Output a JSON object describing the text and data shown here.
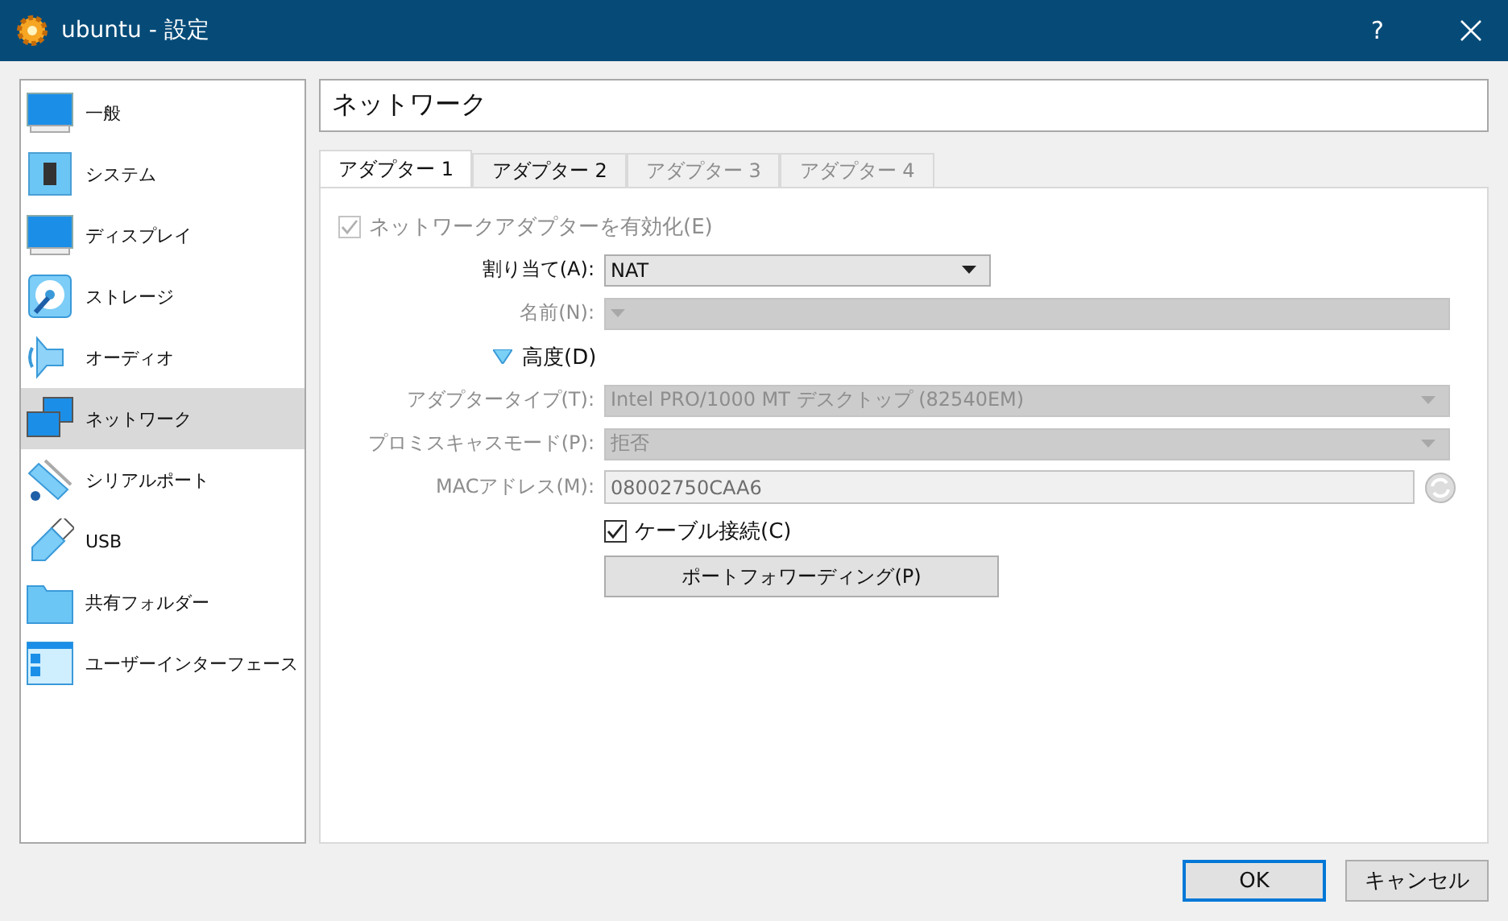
{
  "window": {
    "title": "ubuntu - 設定",
    "help": "?"
  },
  "sidebar": {
    "items": [
      {
        "label": "一般",
        "selected": false
      },
      {
        "label": "システム",
        "selected": false
      },
      {
        "label": "ディスプレイ",
        "selected": false
      },
      {
        "label": "ストレージ",
        "selected": false
      },
      {
        "label": "オーディオ",
        "selected": false
      },
      {
        "label": "ネットワーク",
        "selected": true
      },
      {
        "label": "シリアルポート",
        "selected": false
      },
      {
        "label": "USB",
        "selected": false
      },
      {
        "label": "共有フォルダー",
        "selected": false
      },
      {
        "label": "ユーザーインターフェース",
        "selected": false
      }
    ]
  },
  "page_title": "ネットワーク",
  "tabs": [
    {
      "label": "アダプター 1",
      "selected": true,
      "disabled": false
    },
    {
      "label": "アダプター 2",
      "selected": false,
      "disabled": false
    },
    {
      "label": "アダプター 3",
      "selected": false,
      "disabled": true
    },
    {
      "label": "アダプター 4",
      "selected": false,
      "disabled": true
    }
  ],
  "form": [
    {
      "kind": "checkbox",
      "label": "ネットワークアダプターを有効化(E)",
      "checked": true,
      "disabled": true
    },
    {
      "kind": "select",
      "label": "割り当て(A):",
      "value": "NAT",
      "disabled": false
    },
    {
      "kind": "select",
      "label": "名前(N):",
      "disabled": true
    },
    {
      "kind": "expander",
      "label": "高度(D)",
      "expanded": true
    },
    {
      "kind": "select",
      "label": "アダプタータイプ(T):",
      "value": "Intel PRO/1000 MT デスクトップ (82540EM)",
      "disabled": true
    },
    {
      "kind": "select",
      "label": "プロミスキャスモード(P):",
      "value": "拒否",
      "disabled": true
    },
    {
      "kind": "text",
      "label": "MACアドレス(M):",
      "value": "08002750CAA6",
      "disabled": true
    },
    {
      "kind": "checkbox",
      "label": "ケーブル接続(C)",
      "checked": true,
      "disabled": false
    },
    {
      "kind": "button",
      "label": "ポートフォワーディング(P)"
    }
  ],
  "buttons": [
    "OK",
    "キャンセル"
  ]
}
